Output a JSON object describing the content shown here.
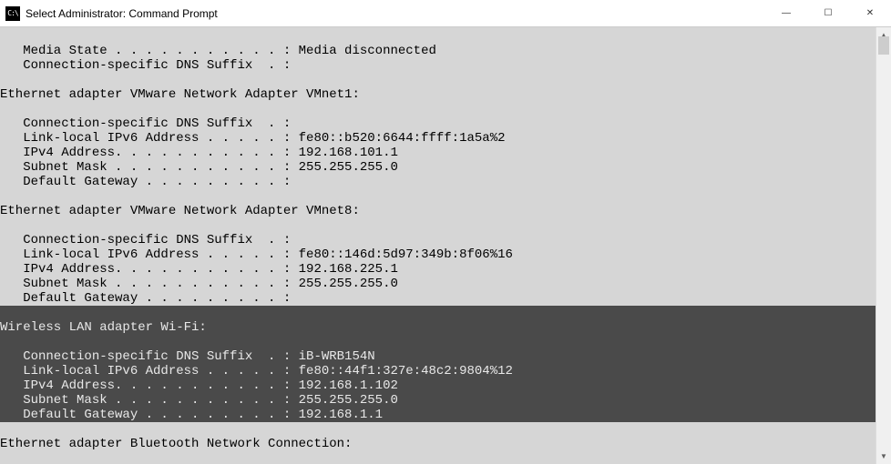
{
  "window": {
    "title": "Select Administrator: Command Prompt",
    "icon_label": "C:\\"
  },
  "controls": {
    "minimize": "—",
    "maximize": "☐",
    "close": "✕"
  },
  "terminal": {
    "lines": [
      {
        "text": "",
        "hl": false
      },
      {
        "text": "   Media State . . . . . . . . . . . : Media disconnected",
        "hl": false
      },
      {
        "text": "   Connection-specific DNS Suffix  . :",
        "hl": false
      },
      {
        "text": "",
        "hl": false
      },
      {
        "text": "Ethernet adapter VMware Network Adapter VMnet1:",
        "hl": false
      },
      {
        "text": "",
        "hl": false
      },
      {
        "text": "   Connection-specific DNS Suffix  . :",
        "hl": false
      },
      {
        "text": "   Link-local IPv6 Address . . . . . : fe80::b520:6644:ffff:1a5a%2",
        "hl": false
      },
      {
        "text": "   IPv4 Address. . . . . . . . . . . : 192.168.101.1",
        "hl": false
      },
      {
        "text": "   Subnet Mask . . . . . . . . . . . : 255.255.255.0",
        "hl": false
      },
      {
        "text": "   Default Gateway . . . . . . . . . :",
        "hl": false
      },
      {
        "text": "",
        "hl": false
      },
      {
        "text": "Ethernet adapter VMware Network Adapter VMnet8:",
        "hl": false
      },
      {
        "text": "",
        "hl": false
      },
      {
        "text": "   Connection-specific DNS Suffix  . :",
        "hl": false
      },
      {
        "text": "   Link-local IPv6 Address . . . . . : fe80::146d:5d97:349b:8f06%16",
        "hl": false
      },
      {
        "text": "   IPv4 Address. . . . . . . . . . . : 192.168.225.1",
        "hl": false
      },
      {
        "text": "   Subnet Mask . . . . . . . . . . . : 255.255.255.0",
        "hl": false
      },
      {
        "text": "   Default Gateway . . . . . . . . . :",
        "hl": false
      },
      {
        "text": "",
        "hl": true
      },
      {
        "text": "Wireless LAN adapter Wi-Fi:",
        "hl": true
      },
      {
        "text": "",
        "hl": true
      },
      {
        "text": "   Connection-specific DNS Suffix  . : iB-WRB154N",
        "hl": true
      },
      {
        "text": "   Link-local IPv6 Address . . . . . : fe80::44f1:327e:48c2:9804%12",
        "hl": true
      },
      {
        "text": "   IPv4 Address. . . . . . . . . . . : 192.168.1.102",
        "hl": true
      },
      {
        "text": "   Subnet Mask . . . . . . . . . . . : 255.255.255.0",
        "hl": true
      },
      {
        "text": "   Default Gateway . . . . . . . . . : 192.168.1.1",
        "hl": true
      },
      {
        "text": "",
        "hl": false
      },
      {
        "text": "Ethernet adapter Bluetooth Network Connection:",
        "hl": false
      },
      {
        "text": "",
        "hl": false
      }
    ]
  }
}
